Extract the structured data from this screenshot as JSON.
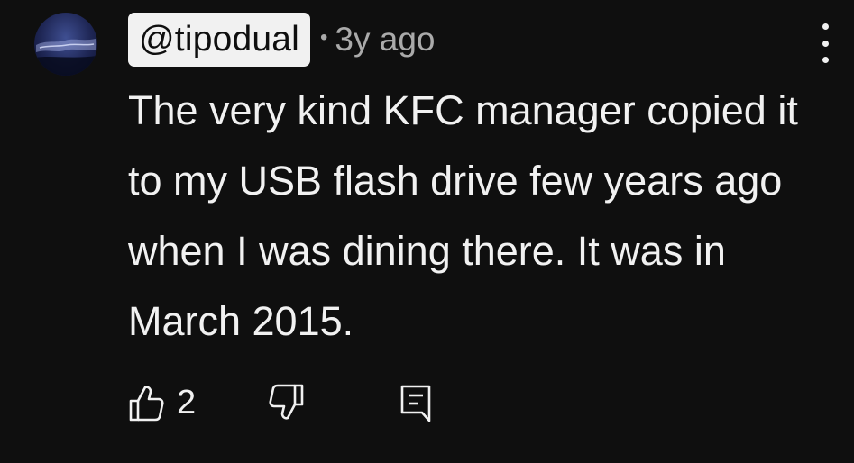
{
  "comment": {
    "author": "@tipodual",
    "separator": "•",
    "time": "3y ago",
    "text": "The very kind KFC manager copied it to my USB flash drive few years ago when I was dining there. It was in March 2015.",
    "like_count": "2"
  },
  "icons": {
    "avatar": "avatar-image",
    "menu": "more-vertical-icon",
    "like": "thumbs-up-icon",
    "dislike": "thumbs-down-icon",
    "reply": "reply-comment-icon"
  },
  "colors": {
    "background": "#0f0f0f",
    "text": "#f1f1f1",
    "secondary_text": "#aaaaaa",
    "author_chip_bg": "#f1f1f1",
    "author_chip_text": "#0f0f0f"
  }
}
